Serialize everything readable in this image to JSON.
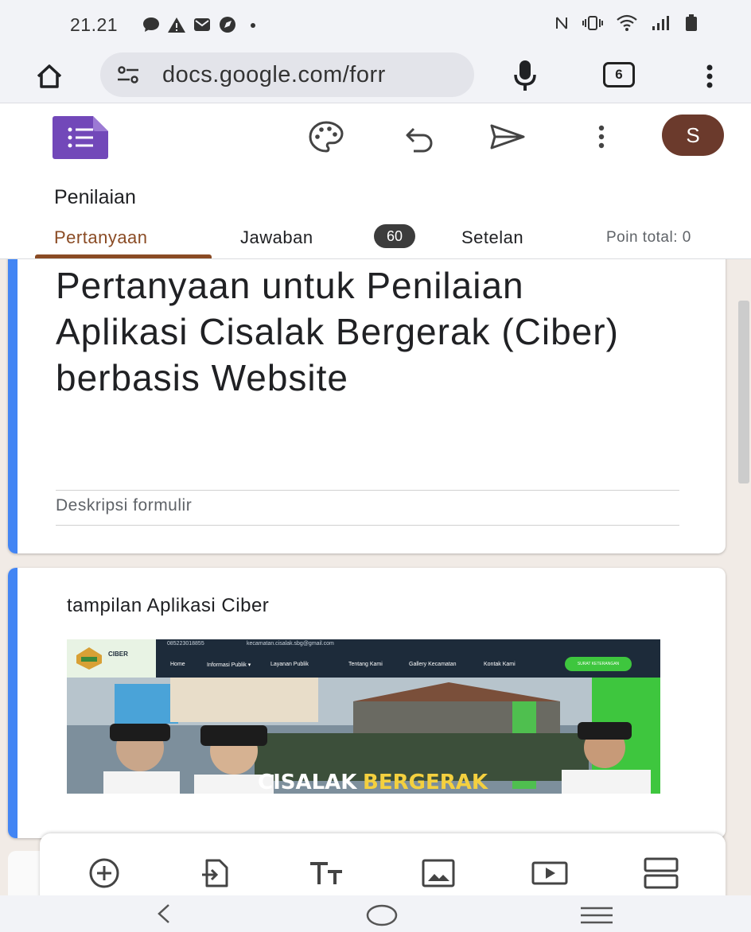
{
  "status_bar": {
    "time": "21.21",
    "left_icons": [
      "chat-icon",
      "warning-icon",
      "mail-icon",
      "compass-icon",
      "dot-icon"
    ],
    "right_icons": [
      "nfc-icon",
      "vibrate-icon",
      "wifi-icon",
      "signal-icon",
      "battery-icon"
    ]
  },
  "browser": {
    "url": "docs.google.com/forr",
    "tab_count": "6"
  },
  "forms_header": {
    "avatar_letter": "S",
    "form_name": "Penilaian",
    "tabs": [
      {
        "label": "Pertanyaan",
        "active": true
      },
      {
        "label": "Jawaban",
        "active": false
      },
      {
        "label": "Setelan",
        "active": false
      }
    ],
    "responses_badge": "60",
    "total_points": "Poin total: 0"
  },
  "title_card": {
    "title": "Pertanyaan untuk Penilaian Aplikasi Cisalak Bergerak (Ciber) berbasis Website",
    "description_placeholder": "Deskripsi formulir"
  },
  "image_card": {
    "title": "tampilan Aplikasi Ciber",
    "site": {
      "brand": "CIBER",
      "phone": "085223018855",
      "email": "kecamatan.cisalak.sbg@gmail.com",
      "nav": [
        "Home",
        "Informasi Publik ▾",
        "Layanan Publik",
        "Tentang Kami",
        "Gallery Kecamatan",
        "Kontak Kami"
      ],
      "cta": "SURAT KETERANGAN",
      "banner_text": [
        "CISALAK",
        "BERGERAK"
      ]
    }
  },
  "toolbar": {
    "items": [
      "add-question",
      "import-questions",
      "add-title",
      "add-image",
      "add-video",
      "add-section"
    ]
  },
  "colors": {
    "accent": "#4285f4",
    "tab_active": "#8a4b24",
    "forms_purple": "#7248b9",
    "avatar_bg": "#6b3a2c",
    "content_bg": "#f1ebe6"
  }
}
